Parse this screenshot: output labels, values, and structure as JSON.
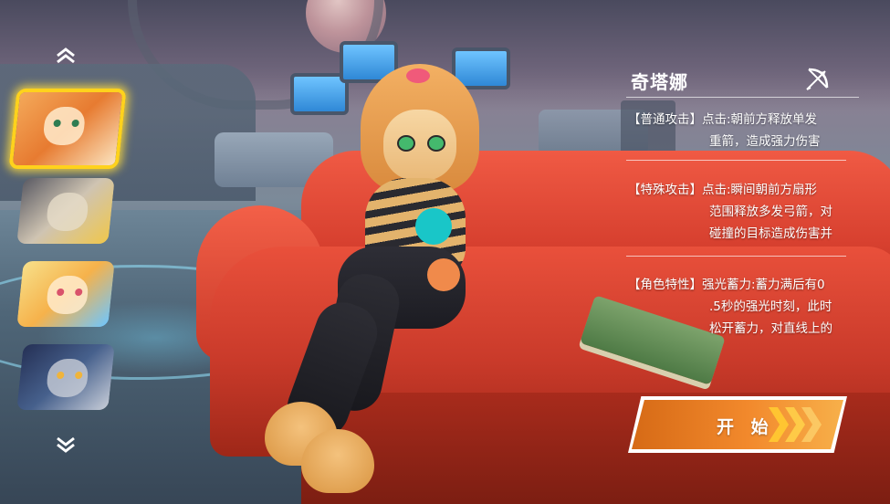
{
  "character": {
    "name": "奇塔娜",
    "weapon_icon": "bow-arrow-icon"
  },
  "skills": [
    {
      "tag": "【普通攻击】",
      "lines": [
        "点击:朝前方释放单发",
        "重箭，造成强力伤害"
      ]
    },
    {
      "tag": "【特殊攻击】",
      "lines": [
        "点击:瞬间朝前方扇形",
        "范围释放多发弓箭，对",
        "碰撞的目标造成伤害并"
      ]
    },
    {
      "tag": "【角色特性】",
      "lines": [
        "强光蓄力:蓄力满后有0",
        ".5秒的强光时刻，此时",
        "松开蓄力，对直线上的"
      ]
    }
  ],
  "start_button": {
    "label": "开 始"
  },
  "carousel": {
    "up_icon": "chevron-up-icon",
    "down_icon": "chevron-down-icon",
    "portraits": [
      {
        "id": "portrait-orange-cat",
        "selected": true
      },
      {
        "id": "portrait-hat-beast",
        "selected": false
      },
      {
        "id": "portrait-blonde-fox",
        "selected": false
      },
      {
        "id": "portrait-dark-wolf",
        "selected": false
      }
    ]
  },
  "colors": {
    "selection": "#ffd21c",
    "start_button": "#f2892c",
    "joystick_cyan": "#19c6c8",
    "joystick_orange": "#f08a4b"
  }
}
